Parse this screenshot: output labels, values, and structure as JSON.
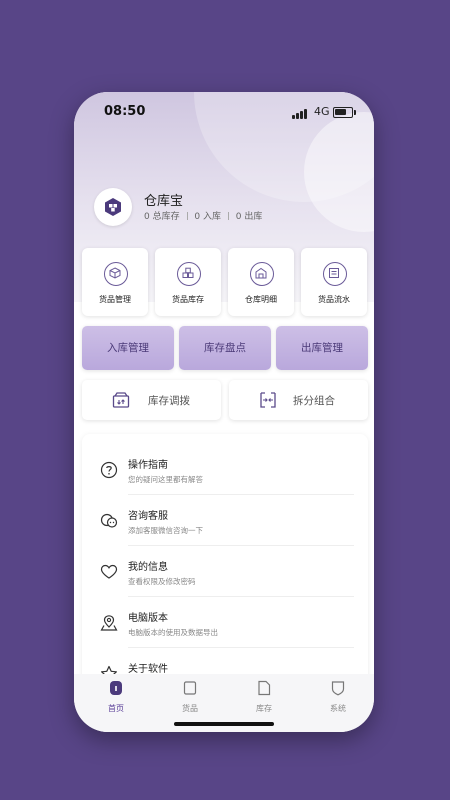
{
  "status_bar": {
    "time": "08:50",
    "network": "4G"
  },
  "profile": {
    "app_name": "仓库宝",
    "stats": [
      {
        "value": "0",
        "label": "总库存"
      },
      {
        "value": "0",
        "label": "入库"
      },
      {
        "value": "0",
        "label": "出库"
      }
    ]
  },
  "quick_tiles": [
    {
      "label": "货品管理",
      "icon": "cube-icon"
    },
    {
      "label": "货品库存",
      "icon": "boxes-icon"
    },
    {
      "label": "仓库明细",
      "icon": "warehouse-icon"
    },
    {
      "label": "货品流水",
      "icon": "ledger-icon"
    }
  ],
  "primary_actions": [
    "入库管理",
    "库存盘点",
    "出库管理"
  ],
  "secondary_actions": [
    {
      "label": "库存调拨",
      "icon": "transfer-box-icon"
    },
    {
      "label": "拆分组合",
      "icon": "split-merge-icon"
    }
  ],
  "menu": [
    {
      "title": "操作指南",
      "subtitle": "您的疑问这里都有解答",
      "icon": "question-icon"
    },
    {
      "title": "咨询客服",
      "subtitle": "添加客服微信咨询一下",
      "icon": "chat-icon"
    },
    {
      "title": "我的信息",
      "subtitle": "查看权限及修改密码",
      "icon": "heart-icon"
    },
    {
      "title": "电脑版本",
      "subtitle": "电脑版本的使用及数据导出",
      "icon": "location-icon"
    },
    {
      "title": "关于软件",
      "subtitle": "",
      "icon": "star-icon"
    }
  ],
  "tabs": [
    {
      "label": "首页",
      "icon": "home-icon",
      "active": true
    },
    {
      "label": "货品",
      "icon": "goods-icon",
      "active": false
    },
    {
      "label": "库存",
      "icon": "stock-icon",
      "active": false
    },
    {
      "label": "系统",
      "icon": "shield-icon",
      "active": false
    }
  ],
  "colors": {
    "background": "#584587",
    "accent": "#5a3f98",
    "primary_button": "#c4b5e2"
  }
}
